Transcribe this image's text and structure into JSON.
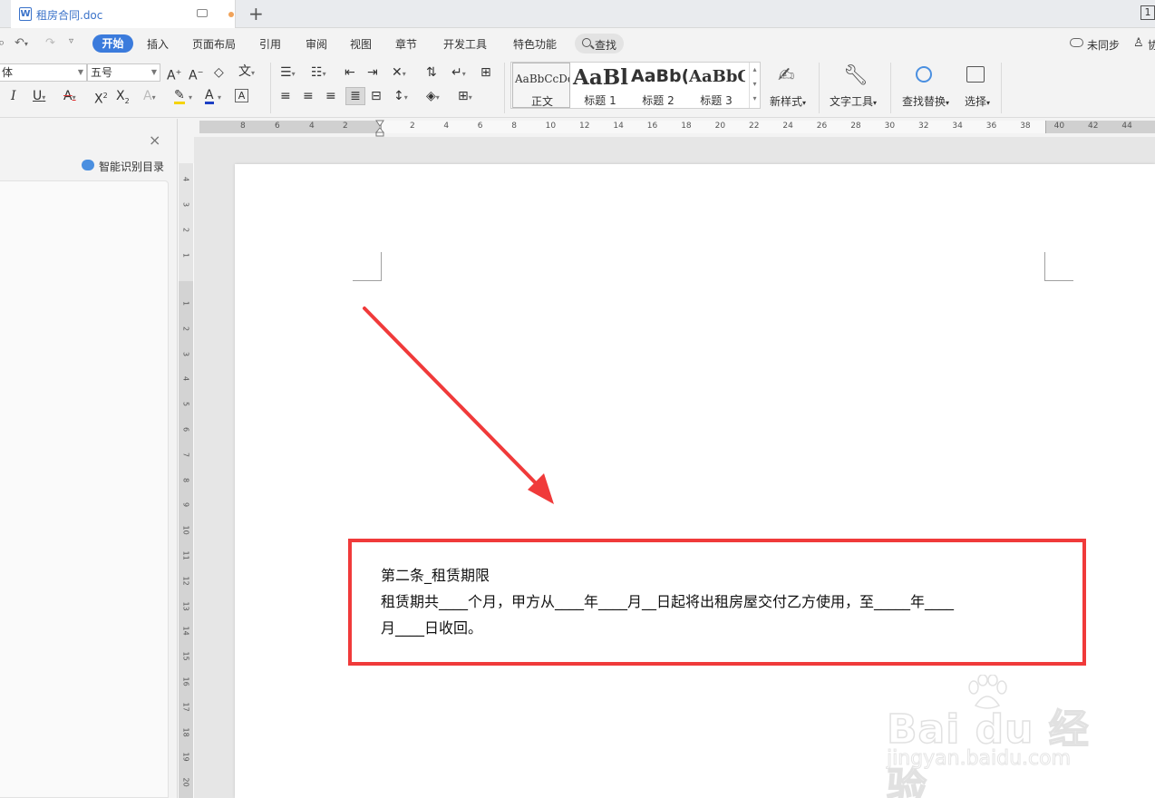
{
  "tab": {
    "filename": "租房合同.doc",
    "new_tab_symbol": "+",
    "window_badge": "1"
  },
  "menu": {
    "items": [
      "开始",
      "插入",
      "页面布局",
      "引用",
      "审阅",
      "视图",
      "章节",
      "开发工具",
      "特色功能"
    ],
    "search_label": "查找",
    "sync_label": "未同步",
    "collab_label": "协"
  },
  "toolbar": {
    "font_name": "体",
    "font_size": "五号",
    "styles": [
      {
        "preview": "AaBbCcDd",
        "name": "正文"
      },
      {
        "preview": "AaBl",
        "name": "标题 1"
      },
      {
        "preview": "AaBb(",
        "name": "标题 2"
      },
      {
        "preview": "AaBbC",
        "name": "标题 3"
      }
    ],
    "new_style_label": "新样式",
    "text_tools_label": "文字工具",
    "find_replace_label": "查找替换",
    "select_label": "选择"
  },
  "pane": {
    "smart_toc_label": "智能识别目录",
    "close_symbol": "×"
  },
  "ruler": {
    "h_left": [
      "8",
      "6",
      "4",
      "2"
    ],
    "h_right": [
      "2",
      "4",
      "6",
      "8",
      "10",
      "12",
      "14",
      "16",
      "18",
      "20",
      "22",
      "24",
      "26",
      "28",
      "30",
      "32",
      "34",
      "36",
      "38",
      "40",
      "42",
      "44"
    ],
    "v_top": [
      "4",
      "3",
      "2",
      "1"
    ],
    "v_body": [
      "1",
      "2",
      "3",
      "4",
      "5",
      "6",
      "7",
      "8",
      "9",
      "10",
      "11",
      "12",
      "13",
      "14",
      "15",
      "16",
      "17",
      "18",
      "19",
      "20"
    ]
  },
  "document": {
    "heading": "第二条_租赁期限",
    "line1": "租赁期共____个月，甲方从____年____月__日起将出租房屋交付乙方使用，至_____年____",
    "line2": "月____日收回。"
  },
  "annotation": {
    "arrow_color": "#f03a3a",
    "box_color": "#f03a3a"
  },
  "watermark": {
    "brand": "Bai du 经验",
    "url": "jingyan.baidu.com"
  },
  "colors": {
    "accent": "#3b7bdc",
    "highlight": "#f03a3a"
  }
}
